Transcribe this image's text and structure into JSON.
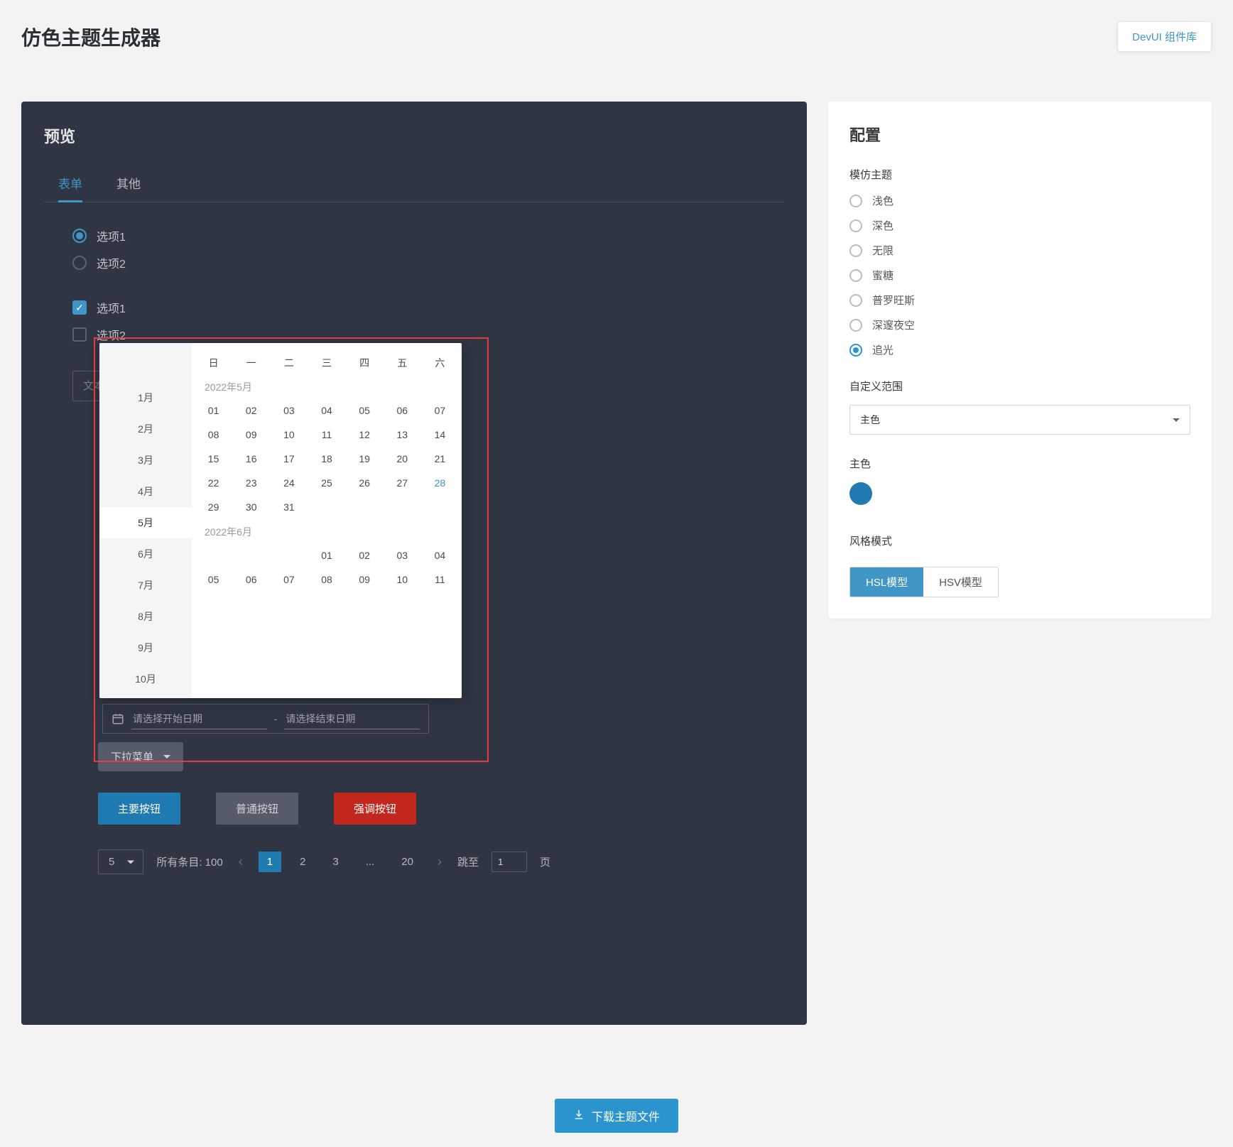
{
  "header": {
    "title": "仿色主题生成器",
    "link_label": "DevUI 组件库"
  },
  "preview": {
    "title": "预览",
    "tabs": [
      {
        "label": "表单",
        "active": true
      },
      {
        "label": "其他",
        "active": false
      }
    ],
    "radio_options": [
      "选项1",
      "选项2"
    ],
    "radio_selected_index": 0,
    "check_options": [
      "选项1",
      "选项2"
    ],
    "check_selected": [
      true,
      false
    ],
    "text_placeholder": "文本框",
    "date_popover": {
      "months": [
        "1月",
        "2月",
        "3月",
        "4月",
        "5月",
        "6月",
        "7月",
        "8月",
        "9月",
        "10月"
      ],
      "selected_month": "5月",
      "weekday_labels": [
        "日",
        "一",
        "二",
        "三",
        "四",
        "五",
        "六"
      ],
      "blocks": [
        {
          "title": "2022年5月",
          "leading_blanks": 0,
          "days": [
            "01",
            "02",
            "03",
            "04",
            "05",
            "06",
            "07",
            "08",
            "09",
            "10",
            "11",
            "12",
            "13",
            "14",
            "15",
            "16",
            "17",
            "18",
            "19",
            "20",
            "21",
            "22",
            "23",
            "24",
            "25",
            "26",
            "27",
            "28",
            "29",
            "30",
            "31"
          ],
          "today": "28"
        },
        {
          "title": "2022年6月",
          "leading_blanks": 3,
          "days": [
            "01",
            "02",
            "03",
            "04",
            "05",
            "06",
            "07",
            "08",
            "09",
            "10",
            "11"
          ],
          "today": null
        }
      ]
    },
    "range_input": {
      "start_placeholder": "请选择开始日期",
      "end_placeholder": "请选择结束日期"
    },
    "dropdown_label": "下拉菜单",
    "buttons": {
      "primary": "主要按钮",
      "normal": "普通按钮",
      "emphasis": "强调按钮"
    },
    "pager": {
      "page_size": "5",
      "total_label": "所有条目: 100",
      "pages": [
        "1",
        "2",
        "3",
        "...",
        "20"
      ],
      "active_page": "1",
      "jump_label": "跳至",
      "jump_value": "1",
      "page_suffix": "页"
    }
  },
  "config": {
    "title": "配置",
    "theme_label": "模仿主题",
    "themes": [
      "浅色",
      "深色",
      "无限",
      "蜜糖",
      "普罗旺斯",
      "深邃夜空",
      "追光"
    ],
    "theme_selected": "追光",
    "range_label": "自定义范围",
    "range_value": "主色",
    "primary_label": "主色",
    "primary_color": "#1f7ab1",
    "mode_label": "风格模式",
    "modes": [
      "HSL模型",
      "HSV模型"
    ],
    "mode_selected": "HSL模型"
  },
  "download_label": "下载主题文件"
}
